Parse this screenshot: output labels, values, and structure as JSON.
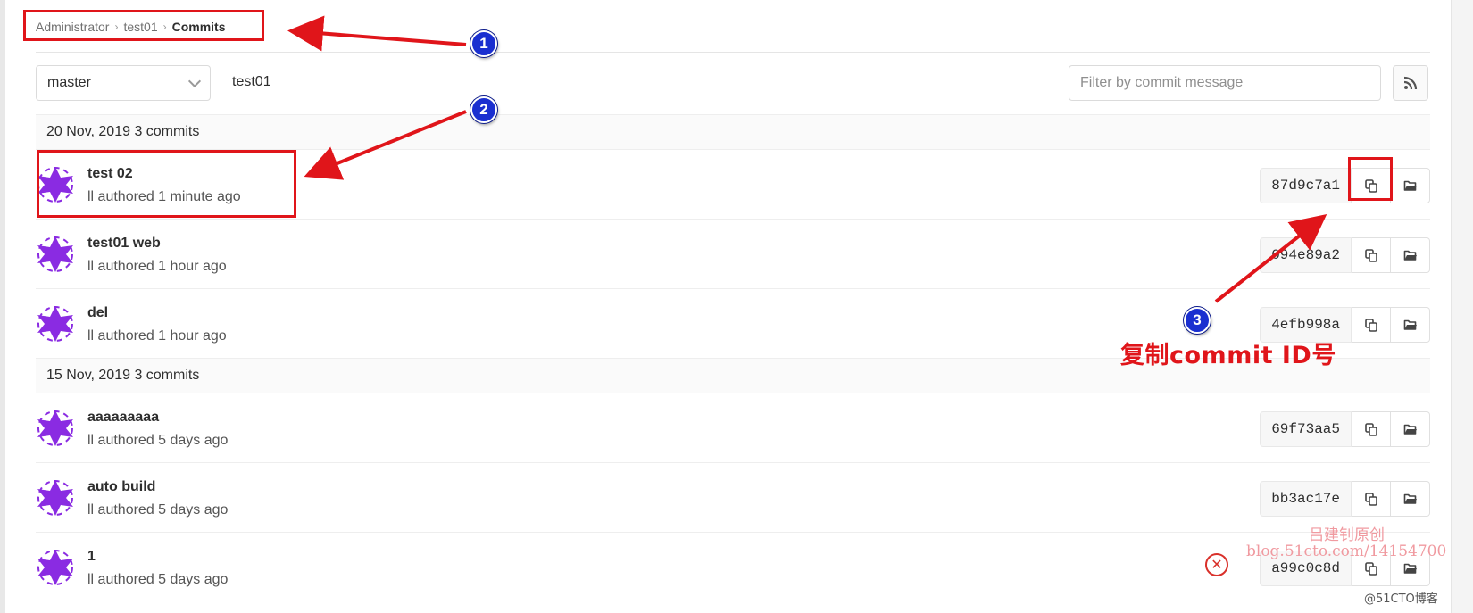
{
  "breadcrumb": {
    "items": [
      "Administrator",
      "test01"
    ],
    "current": "Commits"
  },
  "toolbar": {
    "branch": "master",
    "project_path": "test01",
    "filter_placeholder": "Filter by commit message",
    "rss_icon": "rss-icon"
  },
  "groups": [
    {
      "header": "20 Nov, 2019 3 commits",
      "commits": [
        {
          "title": "test 02",
          "meta": "ll authored 1 minute ago",
          "sha": "87d9c7a1"
        },
        {
          "title": "test01 web",
          "meta": "ll authored 1 hour ago",
          "sha": "094e89a2"
        },
        {
          "title": "del",
          "meta": "ll authored 1 hour ago",
          "sha": "4efb998a"
        }
      ]
    },
    {
      "header": "15 Nov, 2019 3 commits",
      "commits": [
        {
          "title": "aaaaaaaaa",
          "meta": "ll authored 5 days ago",
          "sha": "69f73aa5"
        },
        {
          "title": "auto build",
          "meta": "ll authored 5 days ago",
          "sha": "bb3ac17e"
        },
        {
          "title": "1",
          "meta": "ll authored 5 days ago",
          "sha": "a99c0c8d"
        }
      ]
    }
  ],
  "icons": {
    "copy": "copy-icon",
    "browse": "folder-open-icon",
    "avatar": "identicon-avatar"
  },
  "annotations": {
    "badges": [
      "1",
      "2",
      "3"
    ],
    "caption": "复制commit  ID号",
    "color": "#e0151a"
  },
  "watermark": {
    "author": "吕建钊原创",
    "url": "blog.51cto.com/14154700",
    "site": "@51CTO博客"
  },
  "colors": {
    "avatar": "#8a2be2",
    "badge": "#1a2fd0"
  }
}
